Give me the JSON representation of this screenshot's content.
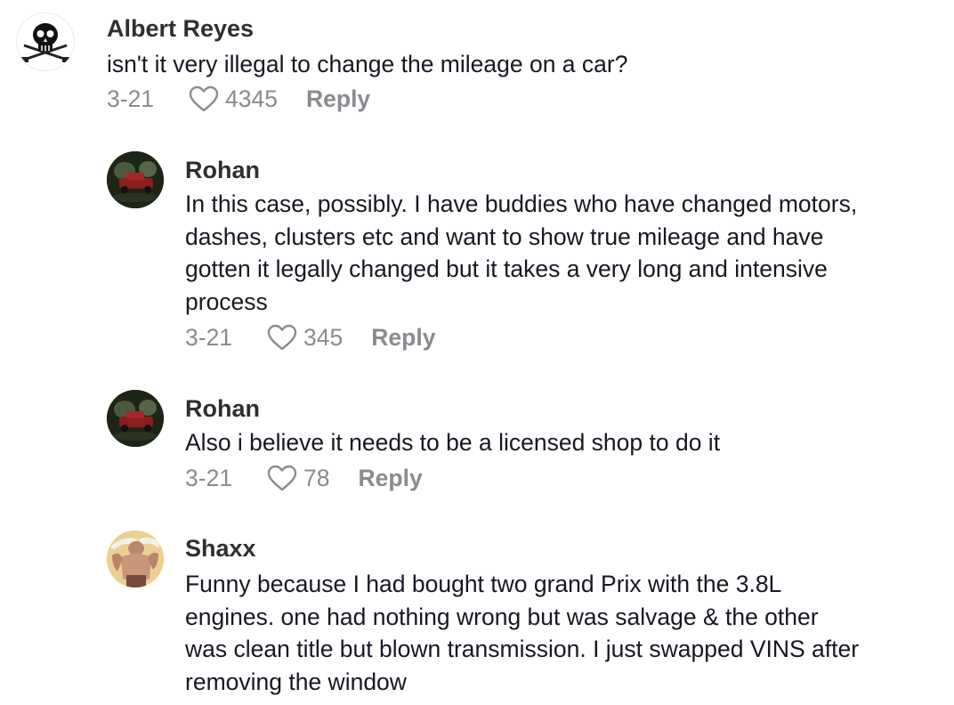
{
  "comments": [
    {
      "author": "Albert Reyes",
      "text": "isn't it very illegal to change the mileage on a car?",
      "date": "3-21",
      "likes": "4345",
      "reply_label": "Reply",
      "avatar_icon": "skull-crossbones-icon"
    },
    {
      "author": "Rohan",
      "text": "In this case, possibly. I have buddies who have changed motors,\ndashes, clusters etc and want to show true mileage and have\ngotten it legally changed but it takes a very long and intensive\nprocess",
      "date": "3-21",
      "likes": "345",
      "reply_label": "Reply",
      "avatar_icon": "car-photo-avatar"
    },
    {
      "author": "Rohan",
      "text": "Also i believe it needs to be a licensed shop to do it",
      "date": "3-21",
      "likes": "78",
      "reply_label": "Reply",
      "avatar_icon": "car-photo-avatar"
    },
    {
      "author": "Shaxx",
      "text": "Funny because I had bought two grand Prix with the 3.8L\nengines. one had nothing wrong but was salvage & the other\nwas clean title but blown transmission. I just swapped VINS after\nremoving the window",
      "date": "",
      "likes": "",
      "reply_label": "",
      "avatar_icon": "warrior-avatar"
    }
  ],
  "colors": {
    "text": "#161823",
    "name": "#2f2f33",
    "meta": "#8a8b91"
  }
}
